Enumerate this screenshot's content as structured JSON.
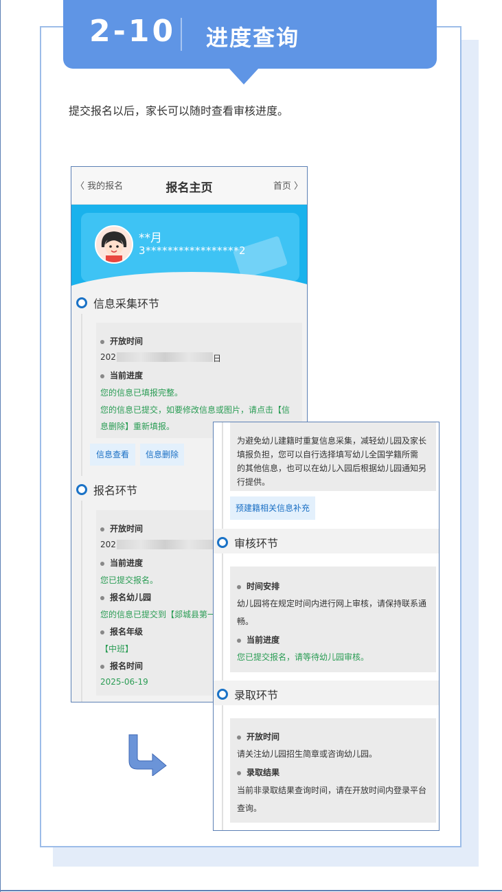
{
  "header": {
    "number": "2-10",
    "title": "进度查询"
  },
  "intro": "提交报名以后，家长可以随时查看审核进度。",
  "phone1": {
    "topbar": {
      "back": "〈 我的报名",
      "title": "报名主页",
      "home": "首页 〉"
    },
    "user": {
      "name": "**月",
      "id": "3*****************2"
    },
    "section1": {
      "title": "信息采集环节",
      "open_time_label": "开放时间",
      "open_time_value_prefix": "202",
      "open_time_value_suffix": "日",
      "progress_label": "当前进度",
      "progress_line1": "您的信息已填报完整。",
      "progress_line2": "您的信息已提交，如要修改信息或图片，请点击【信",
      "progress_line3": "息删除】重新填报。",
      "btn_view": "信息查看",
      "btn_delete": "信息删除"
    },
    "section2": {
      "title": "报名环节",
      "open_time_label": "开放时间",
      "open_time_value_prefix": "202",
      "open_time_value_suffix": "日",
      "progress_label": "当前进度",
      "progress_value": "您已提交报名。",
      "kindergarten_label": "报名幼儿园",
      "kindergarten_value": "您的信息已提交到【郯城县第一",
      "grade_label": "报名年级",
      "grade_value": "【中班】",
      "time_label": "报名时间",
      "time_value": "2025-06-19"
    }
  },
  "phone2": {
    "notice_line1": "为避免幼儿建籍时重复信息采集，减轻幼儿园及家长",
    "notice_line2": "填报负担，您可以自行选择填写幼儿全国学籍所需",
    "notice_line3": "的其他信息，也可以在幼儿入园后根据幼儿园通知另",
    "notice_line4": "行提供。",
    "btn_supplement": "预建籍相关信息补充",
    "section_review": {
      "title": "审核环节",
      "schedule_label": "时间安排",
      "schedule_line1": "幼儿园将在规定时间内进行网上审核，请保持联系通",
      "schedule_line2": "畅。",
      "progress_label": "当前进度",
      "progress_value": "您已提交报名，请等待幼儿园审核。"
    },
    "section_admit": {
      "title": "录取环节",
      "open_time_label": "开放时间",
      "open_time_value": "请关注幼儿园招生简章或咨询幼儿园。",
      "result_label": "录取结果",
      "result_line1": "当前非录取结果查询时间，请在开放时间内登录平台",
      "result_line2": "查询。"
    }
  },
  "colors": {
    "accent": "#5f95e5",
    "link": "#1a6fc4",
    "success": "#2a9c54",
    "banner": "#1ab2ec"
  },
  "icons": {
    "flow_arrow": "arrow-down-right-icon",
    "back": "chevron-left-icon",
    "home": "chevron-right-icon"
  }
}
